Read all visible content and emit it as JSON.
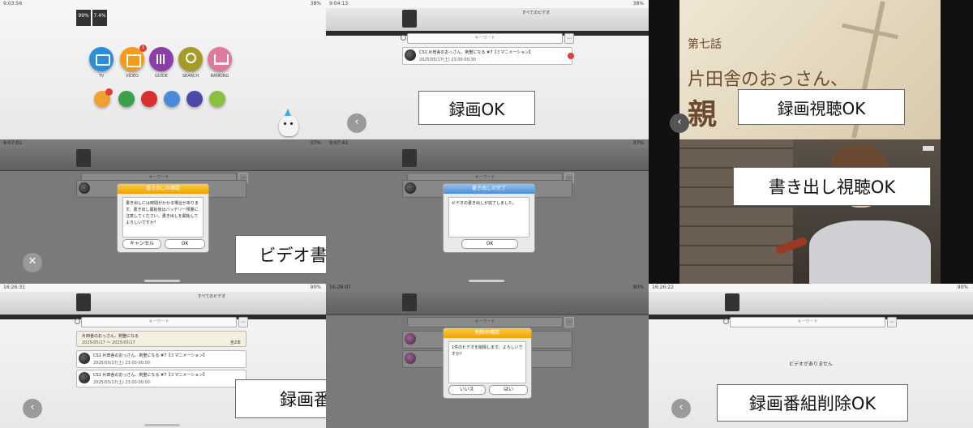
{
  "captions": {
    "record_ok": "録画OK",
    "playback_ok": "録画視聴OK",
    "export_playback_ok": "書き出し視聴OK",
    "video_export_ok": "ビデオ書き出しOK",
    "delete_program": "録画番組削除",
    "delete_program_ok": "録画番組削除OK"
  },
  "status_times": [
    "9:03:56",
    "9:04:13",
    "9:07:01",
    "9:07:41",
    "16:26:31",
    "16:26:07",
    "16:26:22"
  ],
  "status_battery": [
    "38%",
    "38%",
    "37%",
    "37%",
    "90%",
    "90%"
  ],
  "home": {
    "widget_a": "99%",
    "widget_b": "7.4%",
    "icons": [
      "TV",
      "VIDEO",
      "GUIDE",
      "SEARCH",
      "RANKING"
    ],
    "video_badge": "1",
    "colors": [
      "#2a8fd8",
      "#f59b1a",
      "#8a3fa8",
      "#a59a2a",
      "#e07a9a"
    ],
    "small_colors": [
      "#f0a030",
      "#3aa04a",
      "#d83030",
      "#4a8ad8",
      "#4a4aa8",
      "#8ac040"
    ]
  },
  "video_list": {
    "tab_label": "すべてのビデオ",
    "search_placeholder": "キーワード",
    "record_title": "CS1 片田舎のおっさん、剣聖になる #7【ミマニメーション】",
    "record_date": "2025/05/17(土) 23:00-00:30"
  },
  "dialog_export": {
    "title": "書き出しの確認",
    "body": "書き出しには時間がかかる場合があります。書き出し開始後はバッテリー残量に注意してください。書き出しを開始してよろしいですか？",
    "cancel": "キャンセル",
    "ok": "OK"
  },
  "dialog_done": {
    "title": "書き出しの完了",
    "body": "ビデオの書き出しが完了しました。",
    "ok": "OK"
  },
  "dialog_delete": {
    "title": "削除の確認",
    "body": "1件のビデオを削除します。よろしいですか？",
    "no": "いいえ",
    "yes": "はい"
  },
  "delete_list": {
    "folder_title": "片田舎のおっさん、剣聖になる",
    "folder_date": "2025/05/17 〜 2025/05/17",
    "folder_count": "全2本",
    "rec1_date": "2025/05/17(土) 23:00-00:00",
    "rec2_date": "2025/05/17(土) 23:00-00:00"
  },
  "empty": {
    "message": "ビデオがありません"
  },
  "anime": {
    "episode": "第七話",
    "title_line1": "片田舎のおっさん、",
    "title_line2": "親"
  }
}
